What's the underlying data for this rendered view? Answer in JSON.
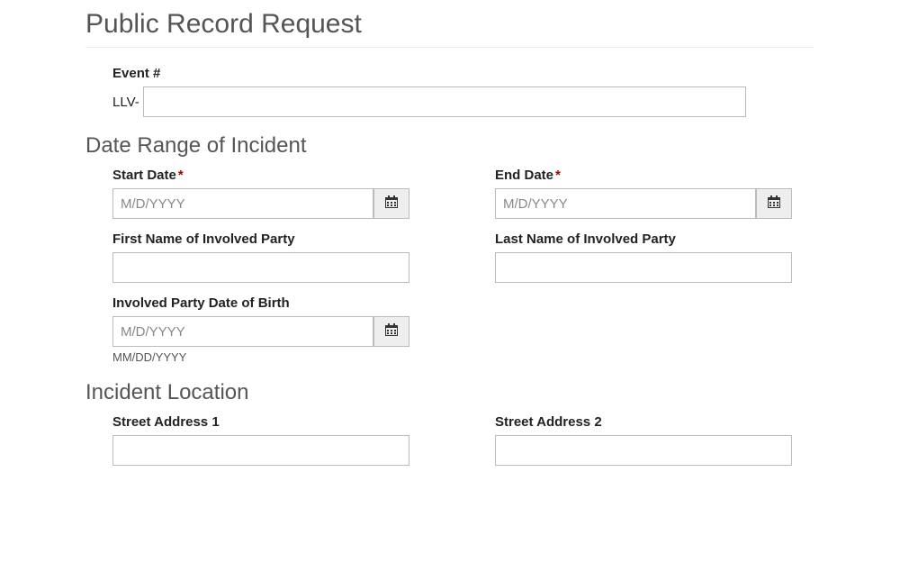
{
  "page_title": "Public Record Request",
  "event": {
    "label": "Event #",
    "prefix": "LLV-",
    "value": ""
  },
  "date_range": {
    "heading": "Date Range of Incident",
    "start": {
      "label": "Start Date",
      "required": "*",
      "placeholder": "M/D/YYYY",
      "value": ""
    },
    "end": {
      "label": "End Date",
      "required": "*",
      "placeholder": "M/D/YYYY",
      "value": ""
    },
    "first_name": {
      "label": "First Name of Involved Party",
      "value": ""
    },
    "last_name": {
      "label": "Last Name of Involved Party",
      "value": ""
    },
    "dob": {
      "label": "Involved Party Date of Birth",
      "placeholder": "M/D/YYYY",
      "value": "",
      "helper": "MM/DD/YYYY"
    }
  },
  "location": {
    "heading": "Incident Location",
    "street1": {
      "label": "Street Address 1",
      "value": ""
    },
    "street2": {
      "label": "Street Address 2",
      "value": ""
    }
  }
}
